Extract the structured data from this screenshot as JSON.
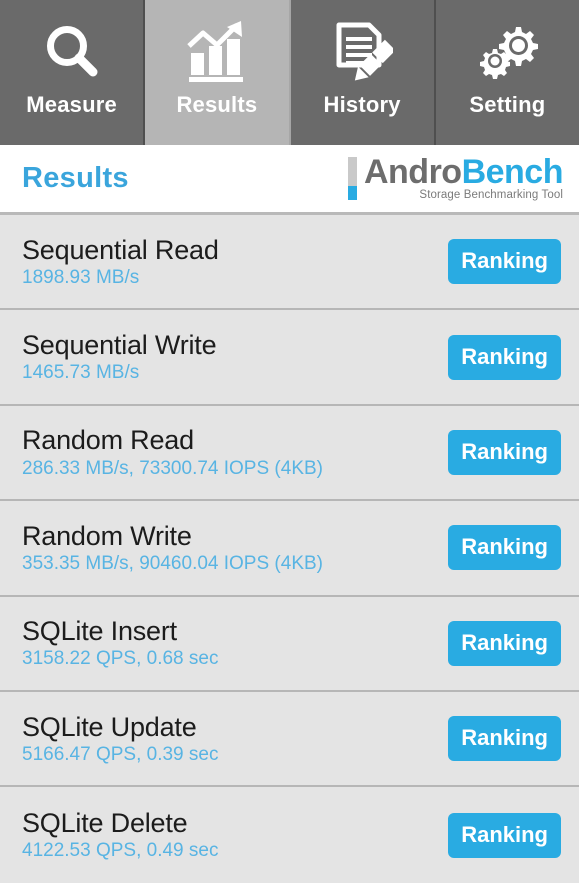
{
  "tabs": [
    {
      "label": "Measure",
      "icon": "magnifier-icon",
      "active": false
    },
    {
      "label": "Results",
      "icon": "bar-chart-growth-icon",
      "active": true
    },
    {
      "label": "History",
      "icon": "document-pencil-icon",
      "active": false
    },
    {
      "label": "Setting",
      "icon": "gears-icon",
      "active": false
    }
  ],
  "header": {
    "title": "Results",
    "logo": {
      "word_primary": "Andro",
      "word_secondary": "Bench",
      "subtitle": "Storage Benchmarking Tool"
    }
  },
  "results": {
    "button_label": "Ranking",
    "rows": [
      {
        "name": "Sequential Read",
        "value": "1898.93 MB/s"
      },
      {
        "name": "Sequential Write",
        "value": "1465.73 MB/s"
      },
      {
        "name": "Random Read",
        "value": "286.33 MB/s, 73300.74 IOPS (4KB)"
      },
      {
        "name": "Random Write",
        "value": "353.35 MB/s, 90460.04 IOPS (4KB)"
      },
      {
        "name": "SQLite Insert",
        "value": "3158.22 QPS, 0.68 sec"
      },
      {
        "name": "SQLite Update",
        "value": "5166.47 QPS, 0.39 sec"
      },
      {
        "name": "SQLite Delete",
        "value": "4122.53 QPS, 0.49 sec"
      }
    ]
  },
  "colors": {
    "accent_blue": "#29abe2",
    "value_blue": "#58b4e3",
    "tab_inactive": "#6a6a6a",
    "tab_active": "#b5b5b5",
    "list_bg": "#e4e4e4",
    "logo_gray": "#6d6d6d"
  }
}
